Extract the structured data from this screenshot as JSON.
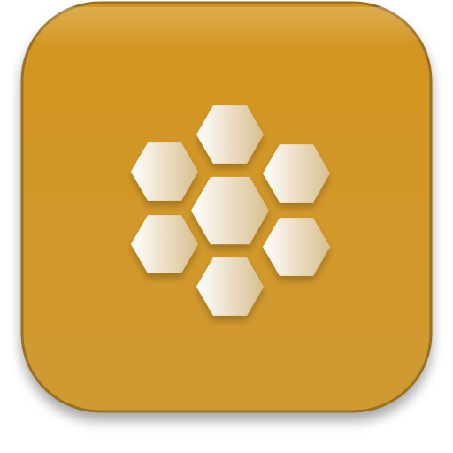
{
  "app_icon": {
    "icon": "honeycomb-icon",
    "colors": {
      "tile_top": "#d4951f",
      "tile_bottom": "#d09a33",
      "tile_border": "#9a7020",
      "hex_light": "#ffffff",
      "hex_dark": "#d8be8e"
    },
    "cells": [
      {
        "id": "top"
      },
      {
        "id": "upper-left"
      },
      {
        "id": "upper-right"
      },
      {
        "id": "center"
      },
      {
        "id": "lower-left"
      },
      {
        "id": "lower-right"
      },
      {
        "id": "bottom"
      }
    ]
  }
}
